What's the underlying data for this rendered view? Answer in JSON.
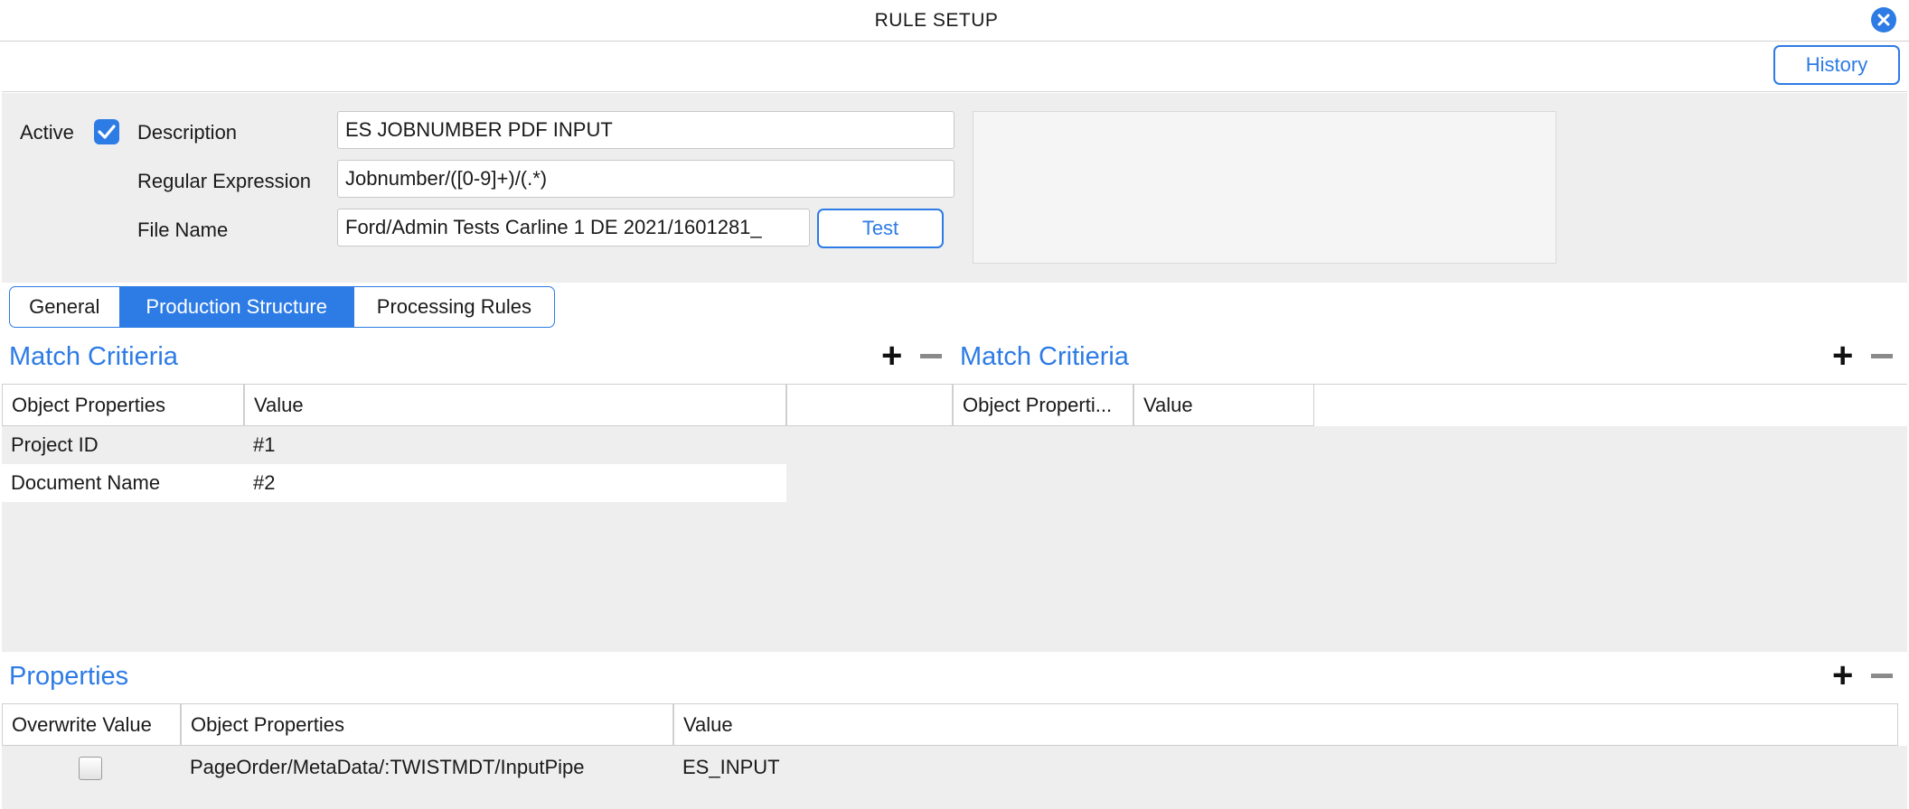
{
  "window": {
    "title": "RULE SETUP"
  },
  "toolbar": {
    "history_label": "History"
  },
  "header": {
    "active_label": "Active",
    "active_checked": true,
    "description_label": "Description",
    "description_value": "ES JOBNUMBER PDF INPUT",
    "regex_label": "Regular Expression",
    "regex_value": "Jobnumber/([0-9]+)/(.*)",
    "filename_label": "File Name",
    "filename_value": "Ford/Admin Tests Carline 1 DE 2021/1601281_",
    "test_label": "Test"
  },
  "tabs": [
    {
      "label": "General",
      "active": false
    },
    {
      "label": "Production Structure",
      "active": true
    },
    {
      "label": "Processing Rules",
      "active": false
    }
  ],
  "match_left": {
    "title": "Match Critieria",
    "columns": [
      "Object Properties",
      "Value"
    ],
    "rows": [
      {
        "property": "Project ID",
        "value": "#1"
      },
      {
        "property": "Document Name",
        "value": "#2"
      }
    ]
  },
  "match_right": {
    "title": "Match Critieria",
    "columns": [
      "Object Properti...",
      "Value"
    ],
    "rows": []
  },
  "properties": {
    "title": "Properties",
    "columns": [
      "Overwrite Value",
      "Object Properties",
      "Value"
    ],
    "rows": [
      {
        "overwrite": false,
        "property": "PageOrder/MetaData/:TWISTMDT/InputPipe",
        "value": "ES_INPUT"
      }
    ]
  },
  "colors": {
    "accent": "#2d7be5",
    "panel_bg": "#eeeeee",
    "minus_grey": "#8a8a8a"
  }
}
